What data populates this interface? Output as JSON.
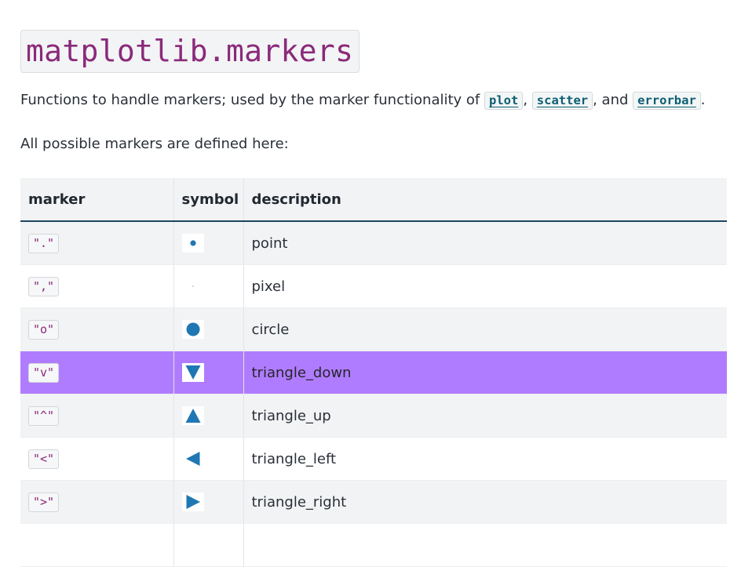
{
  "title": "matplotlib.markers",
  "intro": {
    "prefix": "Functions to handle markers; used by the marker functionality of ",
    "link1": "plot",
    "sep1": ", ",
    "link2": "scatter",
    "sep2": ", and ",
    "link3": "errorbar",
    "suffix": "."
  },
  "defined_text": "All possible markers are defined here:",
  "table": {
    "headers": {
      "marker": "marker",
      "symbol": "symbol",
      "description": "description"
    },
    "rows": [
      {
        "marker": "\".\"",
        "symbol_icon": "point-marker-icon",
        "description": "point"
      },
      {
        "marker": "\",\"",
        "symbol_icon": "pixel-marker-icon",
        "description": "pixel"
      },
      {
        "marker": "\"o\"",
        "symbol_icon": "circle-marker-icon",
        "description": "circle"
      },
      {
        "marker": "\"v\"",
        "symbol_icon": "triangle-down-marker-icon",
        "description": "triangle_down"
      },
      {
        "marker": "\"^\"",
        "symbol_icon": "triangle-up-marker-icon",
        "description": "triangle_up"
      },
      {
        "marker": "\"<\"",
        "symbol_icon": "triangle-left-marker-icon",
        "description": "triangle_left"
      },
      {
        "marker": "\">\"",
        "symbol_icon": "triangle-right-marker-icon",
        "description": "triangle_right"
      }
    ]
  },
  "colors": {
    "marker_blue": "#1f77b4",
    "highlight_row": "#b07cff",
    "code_purple": "#8a2a7a",
    "link_teal": "#0b5e72",
    "header_rule": "#1d4660"
  }
}
